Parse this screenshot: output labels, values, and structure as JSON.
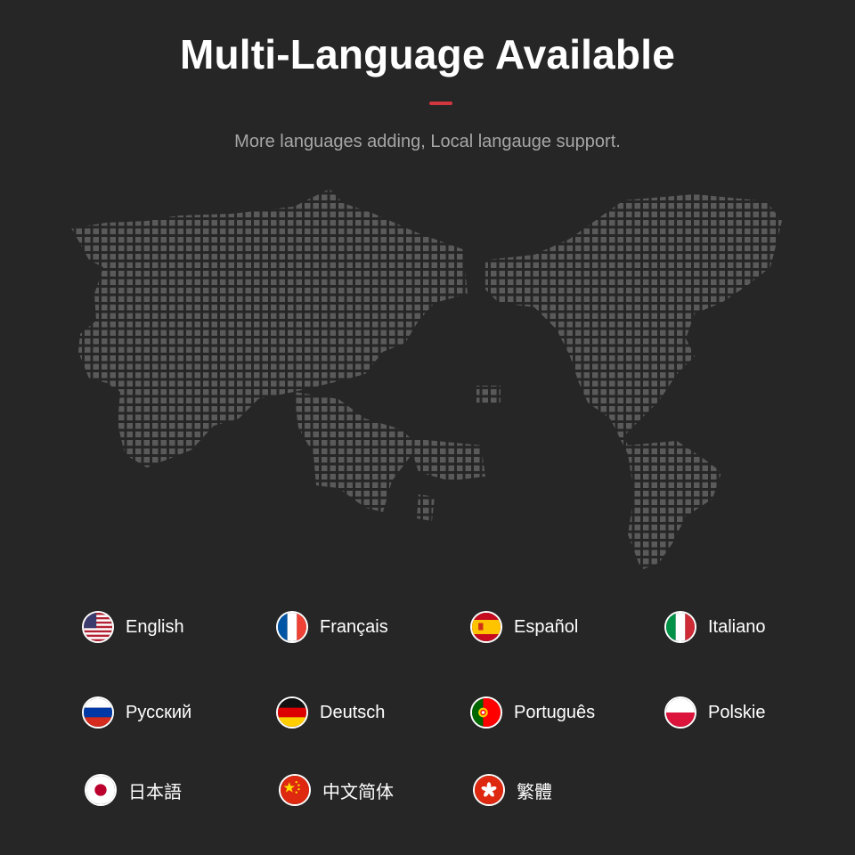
{
  "header": {
    "title": "Multi-Language Available",
    "subtitle": "More languages adding, Local langauge support.",
    "accent_color": "#d2363f"
  },
  "map": {
    "description_icon": "dotted-world-map-icon",
    "dot_color": "#5a5a5a"
  },
  "languages": [
    {
      "label": "English",
      "flag": "us-flag-icon"
    },
    {
      "label": "Français",
      "flag": "france-flag-icon"
    },
    {
      "label": "Español",
      "flag": "spain-flag-icon"
    },
    {
      "label": "Italiano",
      "flag": "italy-flag-icon"
    },
    {
      "label": "Русский",
      "flag": "russia-flag-icon"
    },
    {
      "label": "Deutsch",
      "flag": "germany-flag-icon"
    },
    {
      "label": "Português",
      "flag": "portugal-flag-icon"
    },
    {
      "label": "Polskie",
      "flag": "poland-flag-icon"
    },
    {
      "label": "日本語",
      "flag": "japan-flag-icon"
    },
    {
      "label": "中文简体",
      "flag": "china-flag-icon"
    },
    {
      "label": "繁體",
      "flag": "hong-kong-flag-icon"
    }
  ]
}
